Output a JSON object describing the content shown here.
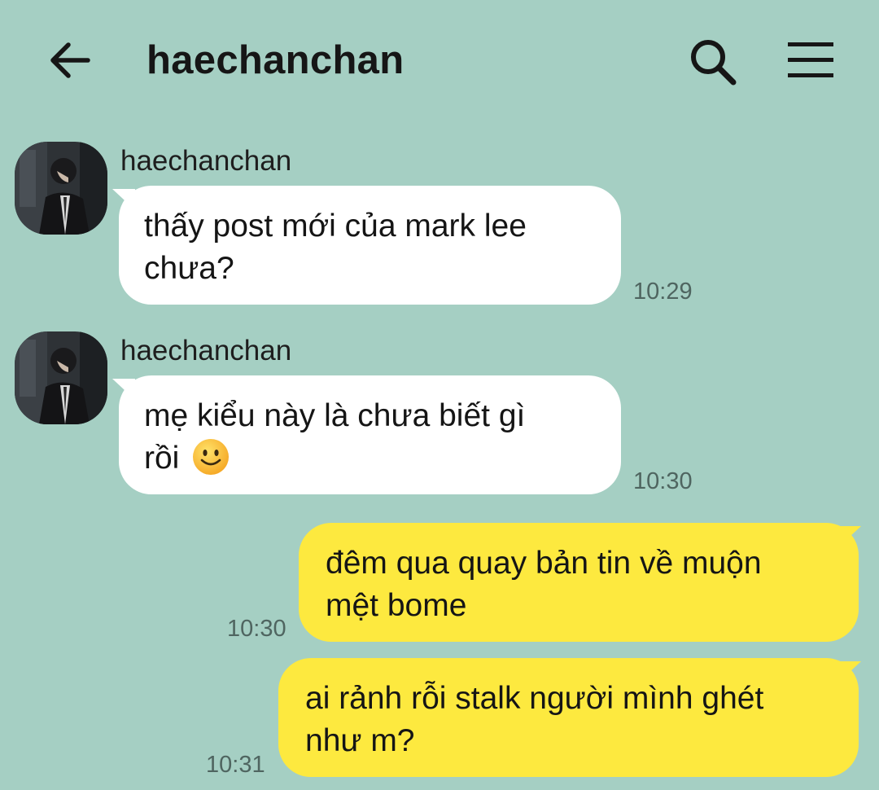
{
  "header": {
    "title": "haechanchan",
    "back_icon": "arrow-left-icon",
    "search_icon": "search-icon",
    "menu_icon": "menu-icon"
  },
  "colors": {
    "background": "#a5cfc3",
    "incoming_bubble": "#ffffff",
    "outgoing_bubble": "#fde93f"
  },
  "messages": [
    {
      "direction": "incoming",
      "sender": "haechanchan",
      "lines": [
        "thấy post mới của mark lee",
        "chưa?"
      ],
      "time": "10:29"
    },
    {
      "direction": "incoming",
      "sender": "haechanchan",
      "lines": [
        "mẹ kiểu này là chưa biết gì",
        "rồi"
      ],
      "emoji": "slightly-smiling-face-icon",
      "time": "10:30"
    },
    {
      "direction": "outgoing",
      "lines": [
        "đêm qua quay bản tin về muộn",
        "mệt bome"
      ],
      "time": "10:30"
    },
    {
      "direction": "outgoing",
      "lines": [
        "ai rảnh rỗi stalk người mình ghét",
        "như m?"
      ],
      "time": "10:31"
    }
  ]
}
